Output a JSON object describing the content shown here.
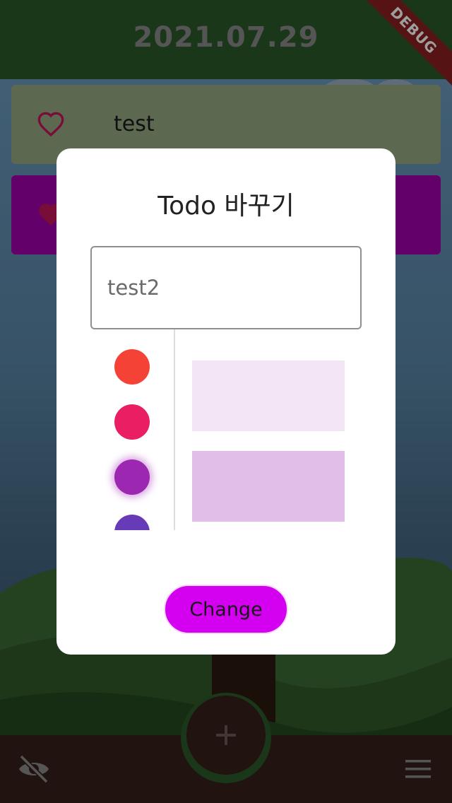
{
  "appbar": {
    "title": "2021.07.29",
    "debug_banner": "DEBUG",
    "color": "#2b5a2b"
  },
  "todos": [
    {
      "label": "test",
      "color": "#96a883",
      "favorite": false
    },
    {
      "label": "",
      "color": "#a200aa",
      "favorite": true
    }
  ],
  "dialog": {
    "title": "Todo 바꾸기",
    "input_value": "test2",
    "color_swatches": [
      {
        "name": "red",
        "color": "#f44336",
        "selected": false
      },
      {
        "name": "pink",
        "color": "#e91e63",
        "selected": false
      },
      {
        "name": "purple",
        "color": "#9c27b0",
        "selected": true
      },
      {
        "name": "deep-purple",
        "color": "#673ab7",
        "selected": false
      }
    ],
    "shades": [
      {
        "name": "purple-50",
        "color": "#f3e5f5"
      },
      {
        "name": "purple-100",
        "color": "#e1bee7"
      }
    ],
    "change_label": "Change",
    "change_color": "#d400f0"
  },
  "bottombar": {
    "add_icon": "plus-icon",
    "visibility_icon": "eye-off-icon",
    "menu_icon": "menu-icon",
    "color": "#34201a"
  }
}
